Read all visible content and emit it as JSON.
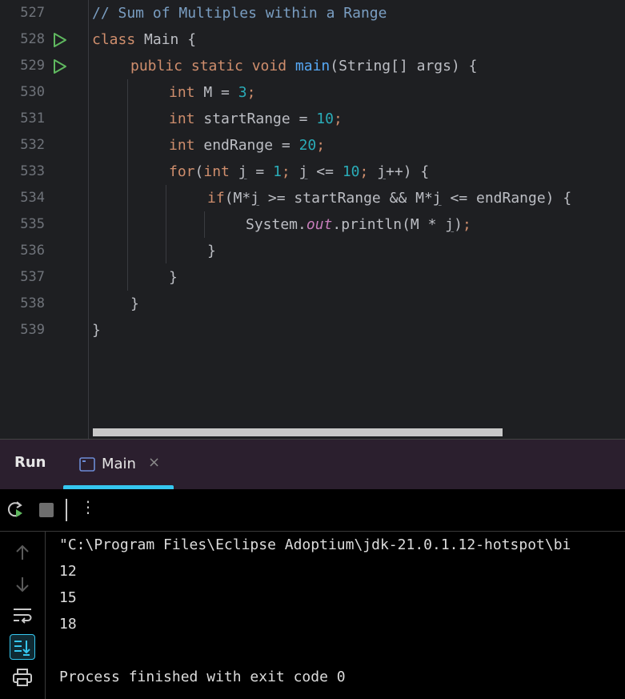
{
  "editor": {
    "lines": [
      {
        "num": "527",
        "run": false,
        "indent": 0,
        "tokens": [
          {
            "c": "cmt",
            "t": "// Sum of Multiples within a Range"
          }
        ]
      },
      {
        "num": "528",
        "run": true,
        "indent": 0,
        "tokens": [
          {
            "c": "kw",
            "t": "class "
          },
          {
            "c": "pl",
            "t": "Main {"
          }
        ]
      },
      {
        "num": "529",
        "run": true,
        "indent": 1,
        "tokens": [
          {
            "c": "kw",
            "t": "public static void "
          },
          {
            "c": "fn",
            "t": "main"
          },
          {
            "c": "pl",
            "t": "(String[] args) {"
          }
        ]
      },
      {
        "num": "530",
        "run": false,
        "indent": 2,
        "tokens": [
          {
            "c": "kw",
            "t": "int "
          },
          {
            "c": "pl",
            "t": "M = "
          },
          {
            "c": "num",
            "t": "3"
          },
          {
            "c": "semi",
            "t": ";"
          }
        ]
      },
      {
        "num": "531",
        "run": false,
        "indent": 2,
        "tokens": [
          {
            "c": "kw",
            "t": "int "
          },
          {
            "c": "pl",
            "t": "startRange = "
          },
          {
            "c": "num",
            "t": "10"
          },
          {
            "c": "semi",
            "t": ";"
          }
        ]
      },
      {
        "num": "532",
        "run": false,
        "indent": 2,
        "tokens": [
          {
            "c": "kw",
            "t": "int "
          },
          {
            "c": "pl",
            "t": "endRange = "
          },
          {
            "c": "num",
            "t": "20"
          },
          {
            "c": "semi",
            "t": ";"
          }
        ]
      },
      {
        "num": "533",
        "run": false,
        "indent": 2,
        "tokens": [
          {
            "c": "kw",
            "t": "for"
          },
          {
            "c": "pl",
            "t": "("
          },
          {
            "c": "kw",
            "t": "int "
          },
          {
            "c": "uvar",
            "t": "j"
          },
          {
            "c": "pl",
            "t": " = "
          },
          {
            "c": "num",
            "t": "1"
          },
          {
            "c": "semi",
            "t": "; "
          },
          {
            "c": "uvar",
            "t": "j"
          },
          {
            "c": "pl",
            "t": " <= "
          },
          {
            "c": "num",
            "t": "10"
          },
          {
            "c": "semi",
            "t": "; "
          },
          {
            "c": "uvar",
            "t": "j"
          },
          {
            "c": "pl",
            "t": "++) {"
          }
        ]
      },
      {
        "num": "534",
        "run": false,
        "indent": 3,
        "tokens": [
          {
            "c": "kw",
            "t": "if"
          },
          {
            "c": "pl",
            "t": "(M*"
          },
          {
            "c": "uvar",
            "t": "j"
          },
          {
            "c": "pl",
            "t": " >= startRange && M*"
          },
          {
            "c": "uvar",
            "t": "j"
          },
          {
            "c": "pl",
            "t": " <= endRange) {"
          }
        ]
      },
      {
        "num": "535",
        "run": false,
        "indent": 4,
        "tokens": [
          {
            "c": "pl",
            "t": "System."
          },
          {
            "c": "field",
            "t": "out"
          },
          {
            "c": "pl",
            "t": ".println(M * "
          },
          {
            "c": "uvar",
            "t": "j"
          },
          {
            "c": "pl",
            "t": ")"
          },
          {
            "c": "semi",
            "t": ";"
          }
        ]
      },
      {
        "num": "536",
        "run": false,
        "indent": 3,
        "tokens": [
          {
            "c": "pl",
            "t": "}"
          }
        ]
      },
      {
        "num": "537",
        "run": false,
        "indent": 2,
        "tokens": [
          {
            "c": "pl",
            "t": "}"
          }
        ]
      },
      {
        "num": "538",
        "run": false,
        "indent": 1,
        "tokens": [
          {
            "c": "pl",
            "t": "}"
          }
        ]
      },
      {
        "num": "539",
        "run": false,
        "indent": 0,
        "tokens": [
          {
            "c": "pl",
            "t": "}"
          }
        ]
      }
    ]
  },
  "run_panel": {
    "title": "Run",
    "tab_label": "Main",
    "tab_close": "×",
    "toolbar_more": "⋮"
  },
  "console": {
    "lines": [
      "\"C:\\Program Files\\Eclipse Adoptium\\jdk-21.0.1.12-hotspot\\bi",
      "12",
      "15",
      "18",
      "",
      "Process finished with exit code 0"
    ]
  },
  "colors": {
    "accent": "#35c7f0",
    "run_icon": "#5fb85f"
  }
}
